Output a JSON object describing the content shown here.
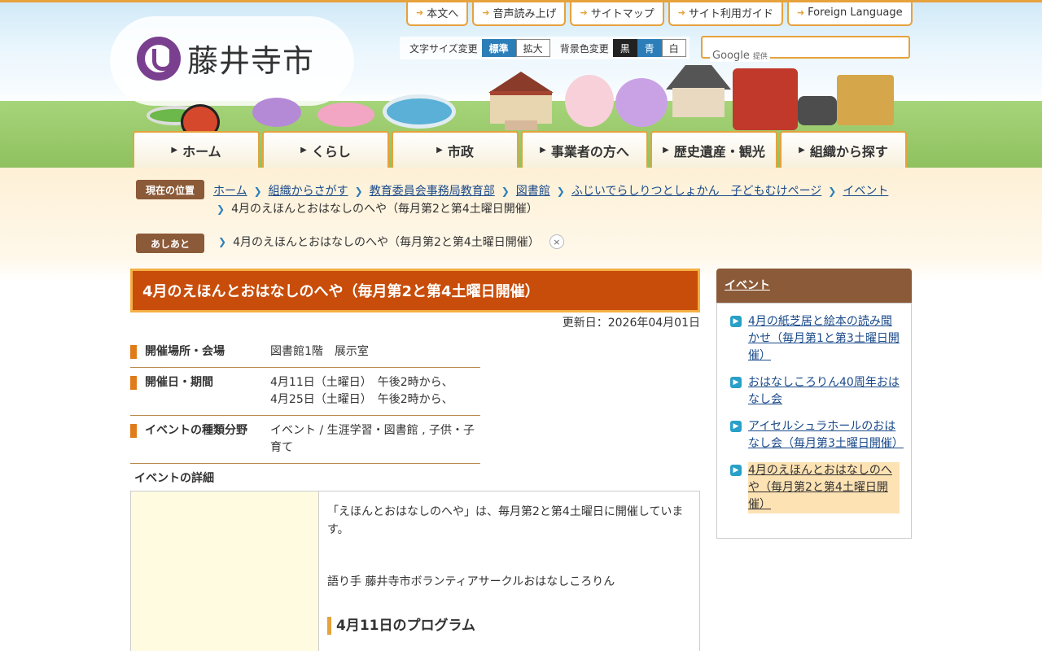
{
  "site": {
    "name": "藤井寺市"
  },
  "util_nav": [
    {
      "label": "本文へ"
    },
    {
      "label": "音声読み上げ"
    },
    {
      "label": "サイトマップ"
    },
    {
      "label": "サイト利用ガイド"
    },
    {
      "label": "Foreign Language"
    }
  ],
  "text_size": {
    "label": "文字サイズ変更",
    "std": "標準",
    "big": "拡大"
  },
  "bg_color": {
    "label": "背景色変更",
    "black": "黒",
    "blue": "青",
    "white": "白"
  },
  "search": {
    "provider": "Google",
    "suffix": "提供"
  },
  "global_nav": [
    {
      "label": "ホーム"
    },
    {
      "label": "くらし"
    },
    {
      "label": "市政"
    },
    {
      "label": "事業者の方へ"
    },
    {
      "label": "歴史遺産・観光"
    },
    {
      "label": "組織から探す"
    }
  ],
  "breadcrumb": {
    "label": "現在の位置",
    "items": [
      "ホーム",
      "組織からさがす",
      "教育委員会事務局教育部",
      "図書館",
      "ふじいでらしりつとしょかん　子どもむけページ",
      "イベント"
    ],
    "current": "4月のえほんとおはなしのへや（毎月第2と第4土曜日開催）"
  },
  "ashiato": {
    "label": "あしあと",
    "item": "4月のえほんとおはなしのへや（毎月第2と第4土曜日開催）",
    "close": "×"
  },
  "page": {
    "title": "4月のえほんとおはなしのへや（毎月第2と第4土曜日開催）",
    "updated": "更新日：2026年04月01日"
  },
  "info": [
    {
      "key": "開催場所・会場",
      "value": [
        "図書館1階　展示室"
      ]
    },
    {
      "key": "開催日・期間",
      "value": [
        "4月11日（土曜日）　午後2時から、",
        "4月25日（土曜日）　午後2時から、"
      ]
    },
    {
      "key": "イベントの種類分野",
      "value": [
        "イベント / 生涯学習・図書館 , 子供・子育て"
      ]
    }
  ],
  "detail": {
    "heading": "イベントの詳細",
    "p1": "「えほんとおはなしのへや」は、毎月第2と第4土曜日に開催しています。",
    "p2": "語り手 藤井寺市ボランティアサークルおはなしころりん",
    "program_heading": "4月11日のプログラム"
  },
  "sidebar": {
    "heading": "イベント",
    "items": [
      {
        "label": "4月の紙芝居と絵本の読み聞かせ（毎月第1と第3土曜日開催）",
        "active": false
      },
      {
        "label": "おはなしころりん40周年おはなし会",
        "active": false
      },
      {
        "label": "アイセルシュラホールのおはなし会（毎月第3土曜日開催）",
        "active": false
      },
      {
        "label": "4月のえほんとおはなしのへや（毎月第2と第4土曜日開催）",
        "active": true
      }
    ]
  },
  "colors": {
    "accent": "#e6a23c",
    "title_bg": "#c84d0a",
    "brown": "#8b5a38",
    "link": "#1a4a8a",
    "brand": "#7b3f8f"
  }
}
